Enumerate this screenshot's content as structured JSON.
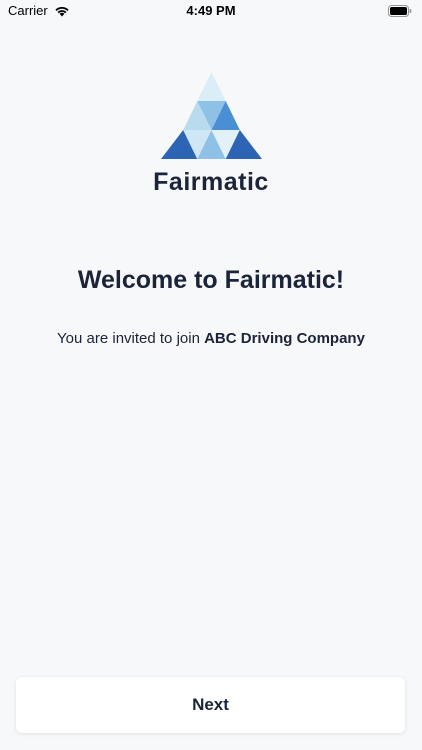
{
  "status_bar": {
    "carrier": "Carrier",
    "time": "4:49 PM",
    "icons": [
      "wifi-icon",
      "battery-icon"
    ]
  },
  "brand": {
    "name": "Fairmatic",
    "logo_icon": "triangle-mosaic-logo",
    "colors": {
      "dark_blue": "#2d64b3",
      "mid_blue": "#4a8fd4",
      "light_blue": "#8fc1e6",
      "pale_blue": "#cfe6f4",
      "lightest_blue": "#e2f0f8"
    }
  },
  "welcome": {
    "title": "Welcome to Fairmatic!",
    "invite_prefix": "You are invited to join",
    "company": "ABC Driving Company"
  },
  "actions": {
    "next_label": "Next"
  },
  "theme": {
    "background": "#f7f8fa",
    "text": "#1b2438"
  }
}
